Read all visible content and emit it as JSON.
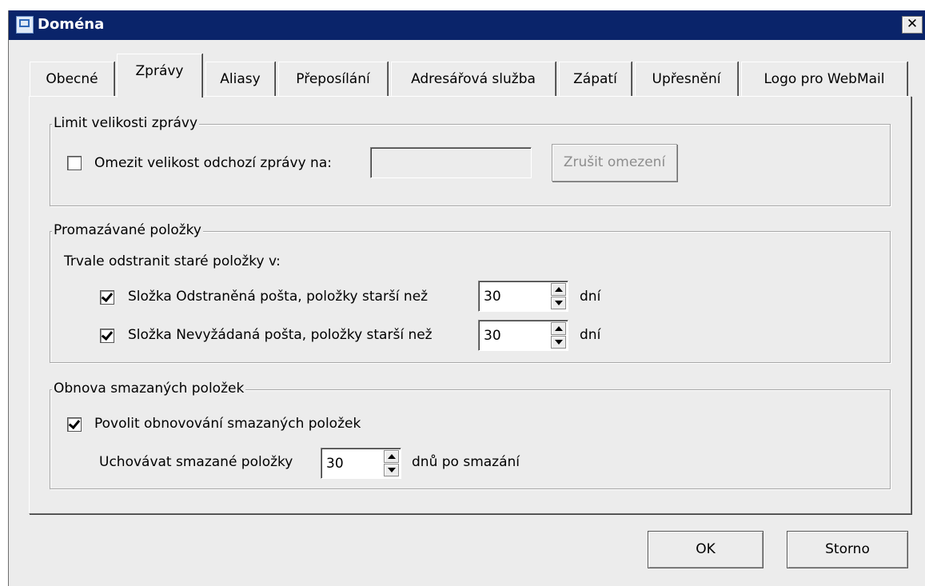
{
  "window": {
    "title": "Doména",
    "close_label": "✕"
  },
  "tabs": [
    {
      "label": "Obecné",
      "active": false
    },
    {
      "label": "Zprávy",
      "active": true
    },
    {
      "label": "Aliasy",
      "active": false
    },
    {
      "label": "Přeposílání",
      "active": false
    },
    {
      "label": "Adresářová služba",
      "active": false
    },
    {
      "label": "Zápatí",
      "active": false
    },
    {
      "label": "Upřesnění",
      "active": false
    },
    {
      "label": "Logo pro WebMail",
      "active": false
    }
  ],
  "size_limit": {
    "legend": "Limit velikosti zprávy",
    "checkbox_label": "Omezit velikost odchozí zprávy na:",
    "checked": false,
    "value": "",
    "clear_button": "Zrušit omezení"
  },
  "purge": {
    "legend": "Promazávané položky",
    "intro": "Trvale odstranit staré položky v:",
    "deleted": {
      "label": "Složka Odstraněná pošta, položky starší než",
      "checked": true,
      "value": "30",
      "unit": "dní"
    },
    "junk": {
      "label": "Složka Nevyžádaná pošta, položky starší než",
      "checked": true,
      "value": "30",
      "unit": "dní"
    }
  },
  "recovery": {
    "legend": "Obnova smazaných položek",
    "checkbox_label": "Povolit obnovování smazaných položek",
    "checked": true,
    "keep_label": "Uchovávat smazané položky",
    "value": "30",
    "unit": "dnů po smazání"
  },
  "buttons": {
    "ok": "OK",
    "cancel": "Storno"
  }
}
